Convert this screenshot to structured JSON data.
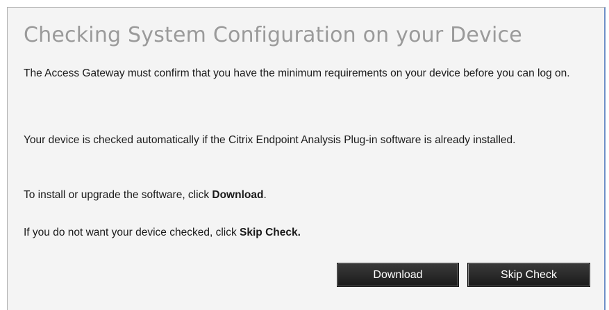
{
  "dialog": {
    "title": "Checking System Configuration on your Device",
    "paragraph1": "The Access Gateway must confirm that you have the minimum requirements on your device before you can log on.",
    "paragraph2": "Your device is checked automatically if the Citrix Endpoint Analysis Plug-in software is already installed.",
    "paragraph3_prefix": "To install or upgrade the software, click ",
    "paragraph3_strong": "Download",
    "paragraph3_suffix": ".",
    "paragraph4_prefix": "If you do not want your device checked, click ",
    "paragraph4_strong": "Skip Check."
  },
  "buttons": {
    "download_label": "Download",
    "skip_check_label": "Skip Check"
  },
  "colors": {
    "accent_border": "#6d8fc7",
    "title_text": "#9a9a9a",
    "button_bg": "#1a1a1a"
  }
}
